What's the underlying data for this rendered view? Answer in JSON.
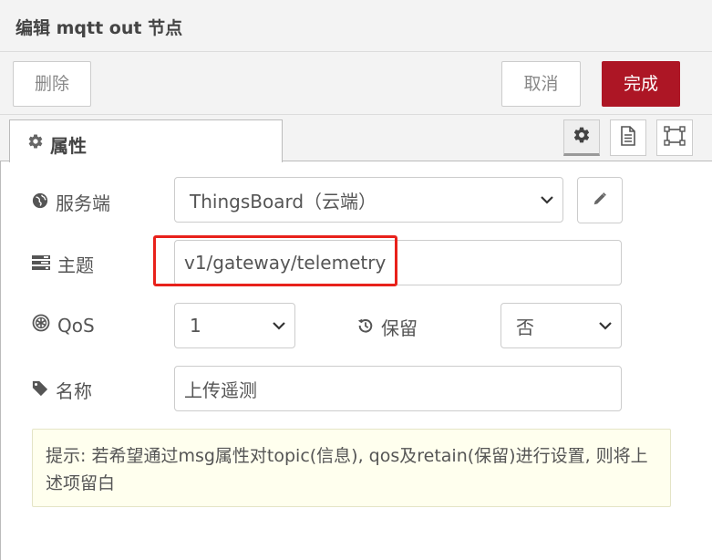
{
  "dialog": {
    "title": "编辑 mqtt out 节点"
  },
  "toolbar": {
    "delete_label": "删除",
    "cancel_label": "取消",
    "done_label": "完成"
  },
  "tabs": {
    "properties_label": "属性"
  },
  "form": {
    "broker": {
      "label": "服务端",
      "value": "ThingsBoard（云端）"
    },
    "topic": {
      "label": "主题",
      "value": "v1/gateway/telemetry"
    },
    "qos": {
      "label": "QoS",
      "value": "1"
    },
    "retain": {
      "label": "保留",
      "value": "否"
    },
    "name": {
      "label": "名称",
      "value": "上传遥测"
    }
  },
  "tip": {
    "text": "提示: 若希望通过msg属性对topic(信息), qos及retain(保留)进行设置, 则将上述项留白"
  },
  "colors": {
    "done_button": "#ad1625",
    "highlight": "#e8211b",
    "tip_background": "#ffffee"
  },
  "icons": [
    "gear-icon",
    "file-text-icon",
    "frame-icon",
    "globe-icon",
    "pencil-icon",
    "tasks-icon",
    "qos-icon",
    "history-icon",
    "tag-icon",
    "chevron-down-icon"
  ]
}
